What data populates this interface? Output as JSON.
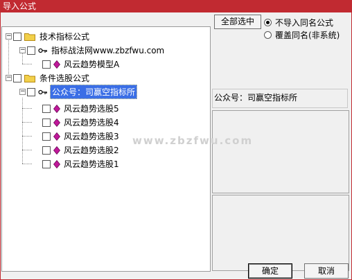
{
  "window": {
    "title": "导入公式"
  },
  "tree": {
    "nodes": [
      {
        "id": "n0",
        "level": 0,
        "icon": "folder",
        "label": "技术指标公式",
        "expanded": true
      },
      {
        "id": "n1",
        "level": 1,
        "icon": "key",
        "label": "指标战法网www.zbzfwu.com",
        "expanded": true
      },
      {
        "id": "n2",
        "level": 2,
        "icon": "gem",
        "label": "风云趋势模型A"
      },
      {
        "id": "n3",
        "level": 0,
        "icon": "folder",
        "label": "条件选股公式",
        "expanded": true
      },
      {
        "id": "n4",
        "level": 1,
        "icon": "key",
        "label": "公众号：司赢空指标所",
        "expanded": true,
        "selected": true
      },
      {
        "id": "n5",
        "level": 2,
        "icon": "gem",
        "label": "风云趋势选股5"
      },
      {
        "id": "n6",
        "level": 2,
        "icon": "gem",
        "label": "风云趋势选股4"
      },
      {
        "id": "n7",
        "level": 2,
        "icon": "gem",
        "label": "风云趋势选股3"
      },
      {
        "id": "n8",
        "level": 2,
        "icon": "gem",
        "label": "风云趋势选股2"
      },
      {
        "id": "n9",
        "level": 2,
        "icon": "gem",
        "label": "风云趋势选股1"
      }
    ]
  },
  "controls": {
    "select_all_label": "全部选中",
    "option_skip_label": "不导入同名公式",
    "option_overwrite_label": "覆盖同名(非系统)",
    "selected_option": "skip"
  },
  "info": {
    "label": "公众号：司赢空指标所"
  },
  "watermark": "www.zbzfwu.com",
  "footer": {
    "ok_label": "确定",
    "cancel_label": "取消"
  },
  "colors": {
    "titlebar": "#c12a31",
    "selection": "#3a6ee6",
    "gem": "#c0189a",
    "folder": "#f2d04a"
  }
}
